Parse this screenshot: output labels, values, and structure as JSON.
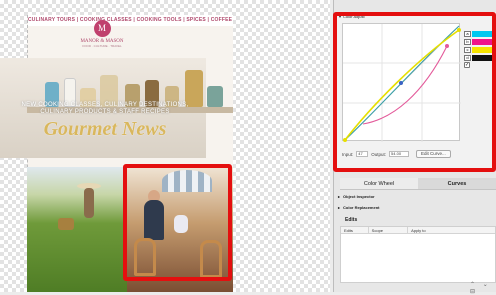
{
  "newsletter": {
    "nav": "CULINARY TOURS | COOKING CLASSES | COOKING TOOLS | SPICES | COFFEE & TEA",
    "logo_mark": "M",
    "logo_name": "MANOR & MASON",
    "logo_sub": "FOOD · CULTURE · TRAVEL",
    "headline_1": "NEW COOKING CLASSES, CULINARY DESTINATIONS,",
    "headline_2": "CULINARY PRODUCTS & STAFF RECIPES",
    "title": "Gourmet News"
  },
  "color_adjust": {
    "title": "Color Adjust",
    "expand_glyph": "▾",
    "swatches": [
      {
        "label": "a",
        "color": "#00c8f0"
      },
      {
        "label": "b",
        "color": "#f0138a"
      },
      {
        "label": "c",
        "color": "#f7e400"
      },
      {
        "label": "d",
        "color": "#111111"
      }
    ],
    "checkbox_mark": "✓",
    "input_label": "Input:",
    "input_value": "47",
    "output_label": "Output:",
    "output_value": "54.00",
    "edit_curve": "Edit Curve..."
  },
  "tabs": [
    {
      "label": "Color Wheel",
      "active": false
    },
    {
      "label": "Curves",
      "active": true
    }
  ],
  "sections": {
    "object_inspector": "Object Inspector",
    "color_replacement": "Color Replacement",
    "edits": "Edits",
    "collapsed_glyph": "▸"
  },
  "edits_table": {
    "columns": [
      "Edits",
      "Scope",
      "Apply to"
    ]
  },
  "bottom_icons": "⌃ ⌄ ⊟",
  "colors": {
    "selection_red": "#e40f0f",
    "curve_cyan": "#3aa0a8",
    "curve_magenta": "#e35a9a",
    "curve_yellow": "#e6df00"
  }
}
